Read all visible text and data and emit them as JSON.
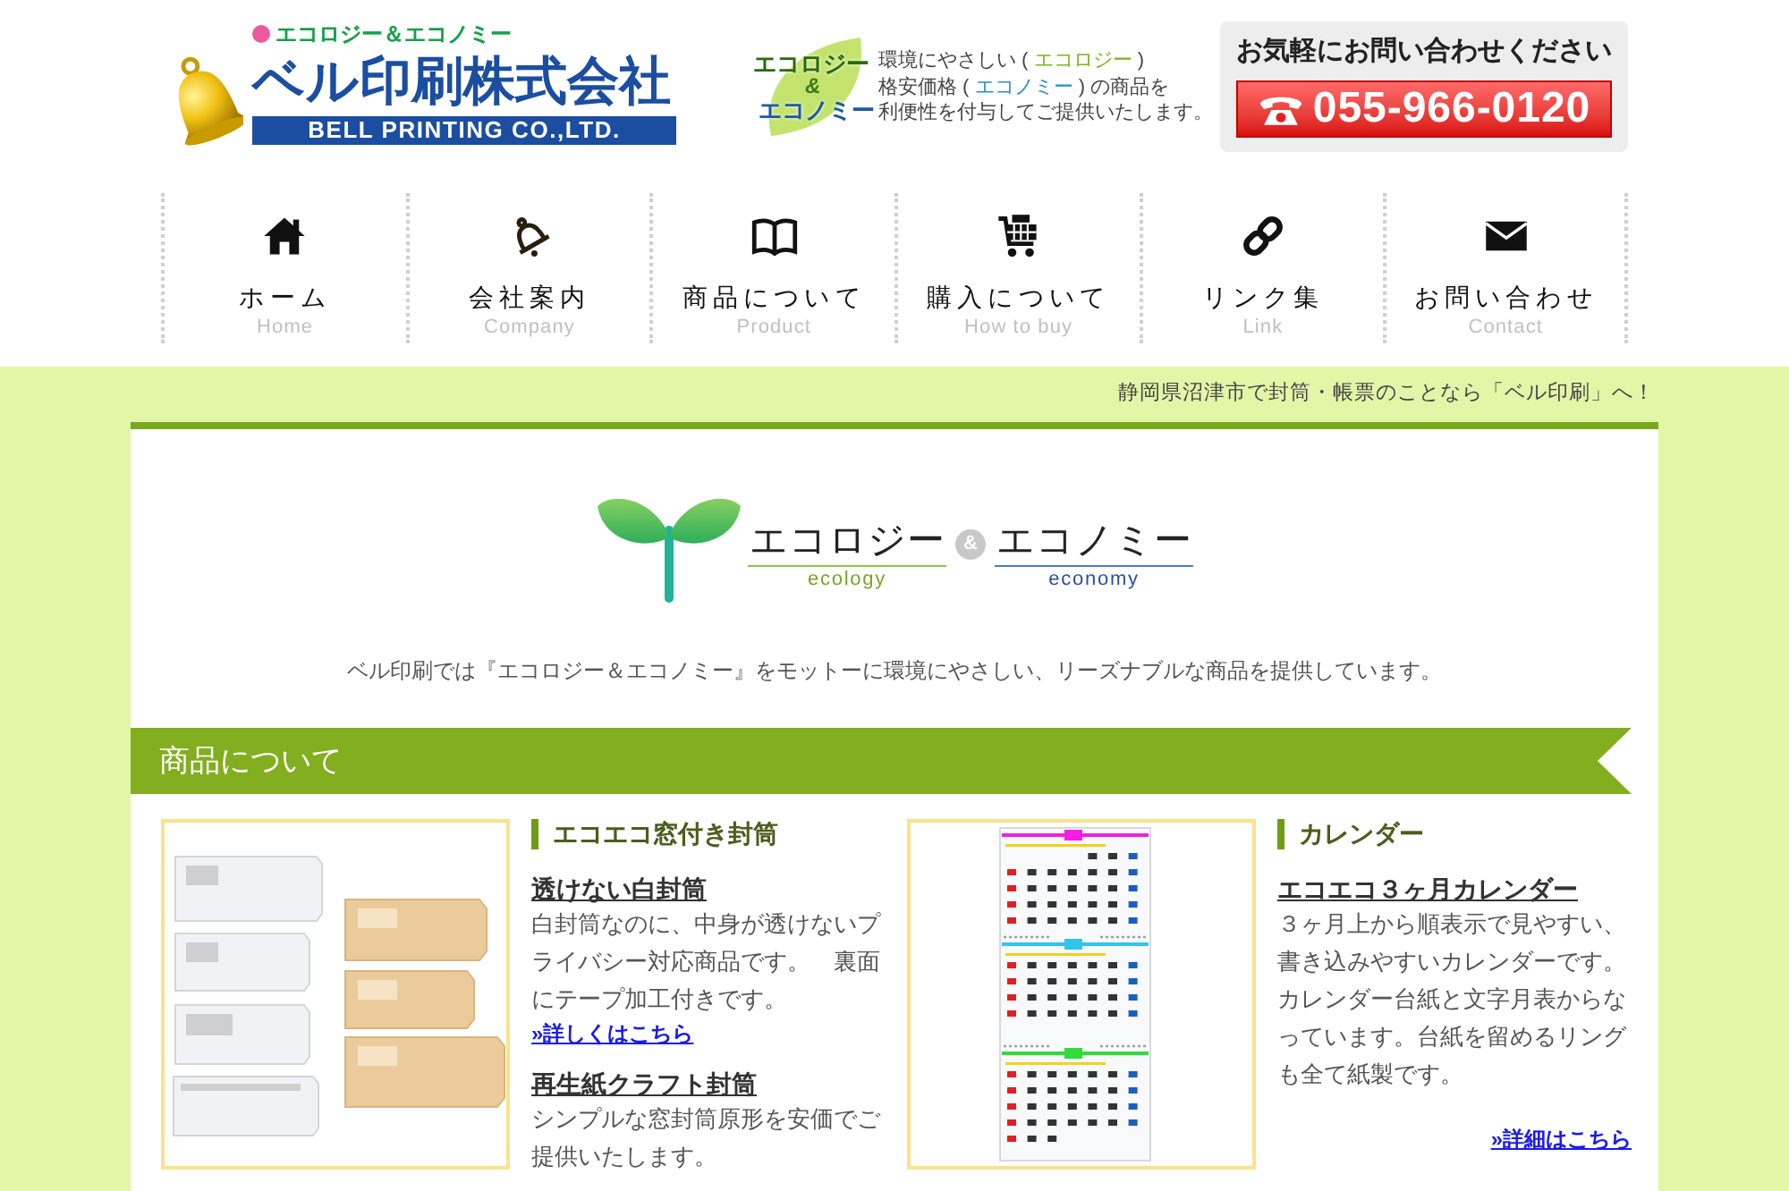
{
  "header": {
    "logo": {
      "tagline": "エコロジー＆エコノミー",
      "company_name": "ベル印刷株式会社",
      "english_name": "BELL PRINTING CO.,LTD."
    },
    "eco_badge": {
      "top": "エコロジー",
      "middle": "&",
      "bottom": "エコノミー"
    },
    "intro": [
      [
        {
          "text": "環境にやさしい ( "
        },
        {
          "text": "エコロジー",
          "color": "#7ab51d"
        },
        {
          "text": " )"
        }
      ],
      [
        {
          "text": "格安価格 ( "
        },
        {
          "text": "エコノミー",
          "color": "#2a8fc0"
        },
        {
          "text": " ) の商品を"
        }
      ],
      [
        {
          "text": "利便性を付与してご提供いたします。"
        }
      ]
    ],
    "contact": {
      "heading": "お気軽にお問い合わせください",
      "phone": "055-966-0120"
    }
  },
  "nav": [
    {
      "label": "ホーム",
      "sublabel": "Home"
    },
    {
      "label": "会社案内",
      "sublabel": "Company"
    },
    {
      "label": "商品について",
      "sublabel": "Product"
    },
    {
      "label": "購入について",
      "sublabel": "How to buy"
    },
    {
      "label": "リンク集",
      "sublabel": "Link"
    },
    {
      "label": "お問い合わせ",
      "sublabel": "Contact"
    }
  ],
  "strapline": "静岡県沼津市で封筒・帳票のことなら「ベル印刷」へ！",
  "motto_logo": {
    "left_word": "エコロジー",
    "left_caption": "ecology",
    "ampersand": "&",
    "right_word": "エコノミー",
    "right_caption": "economy"
  },
  "motto_text": "ベル印刷では『エコロジー＆エコノミー』をモットーに環境にやさしい、リーズナブルな商品を提供しています。",
  "section": {
    "title": "商品について",
    "products": [
      {
        "kind": "envelopes",
        "category": "エコエコ窓付き封筒",
        "items": [
          {
            "title": "透けない白封筒",
            "description": "白封筒なのに、中身が透けないプライバシー対応商品です。　裏面にテープ加工付きです。",
            "link": "»詳しくはこちら"
          },
          {
            "title": "再生紙クラフト封筒",
            "description": "シンプルな窓封筒原形を安価でご提供いたします。"
          }
        ]
      },
      {
        "kind": "calendar",
        "category": "カレンダー",
        "items": [
          {
            "title": "エコエコ３ヶ月カレンダー",
            "description": "３ヶ月上から順表示で見やすい、書き込みやすいカレンダーです。カレンダー台紙と文字月表からなっています。台紙を留めるリングも全て紙製です。",
            "link": "»詳細はこちら"
          }
        ]
      }
    ]
  }
}
